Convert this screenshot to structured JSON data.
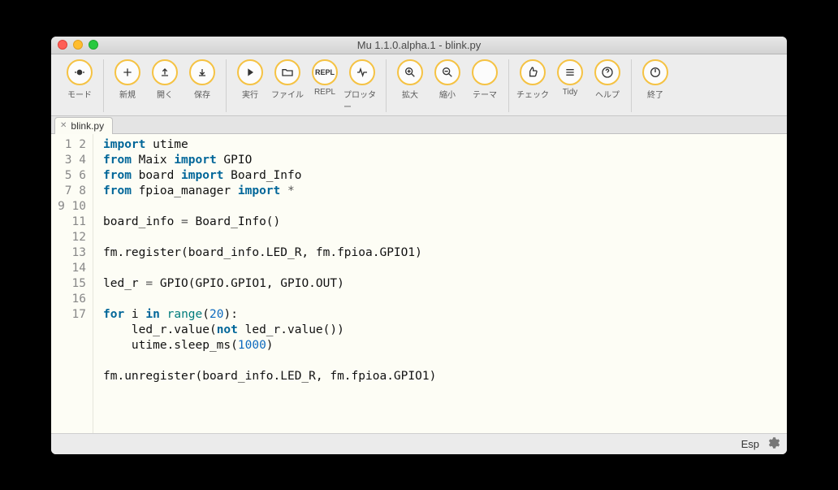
{
  "window": {
    "title": "Mu 1.1.0.alpha.1 - blink.py"
  },
  "toolbar": {
    "groups": [
      [
        {
          "id": "mode",
          "label": "モード",
          "icon": "mode"
        }
      ],
      [
        {
          "id": "new",
          "label": "新規",
          "icon": "plus"
        },
        {
          "id": "open",
          "label": "開く",
          "icon": "upload"
        },
        {
          "id": "save",
          "label": "保存",
          "icon": "download"
        }
      ],
      [
        {
          "id": "run",
          "label": "実行",
          "icon": "play"
        },
        {
          "id": "files",
          "label": "ファイル",
          "icon": "folder"
        },
        {
          "id": "repl",
          "label": "REPL",
          "icon": "kbd",
          "text": "REPL"
        },
        {
          "id": "plotter",
          "label": "プロッター",
          "icon": "pulse"
        }
      ],
      [
        {
          "id": "zoomin",
          "label": "拡大",
          "icon": "zoomin"
        },
        {
          "id": "zoomout",
          "label": "縮小",
          "icon": "zoomout"
        },
        {
          "id": "theme",
          "label": "テーマ",
          "icon": "moon"
        }
      ],
      [
        {
          "id": "check",
          "label": "チェック",
          "icon": "thumb"
        },
        {
          "id": "tidy",
          "label": "Tidy",
          "icon": "list"
        },
        {
          "id": "help",
          "label": "ヘルプ",
          "icon": "help"
        }
      ],
      [
        {
          "id": "quit",
          "label": "終了",
          "icon": "power"
        }
      ]
    ]
  },
  "tab": {
    "filename": "blink.py"
  },
  "code": {
    "lines": 17,
    "tokens": [
      [
        {
          "c": "kw",
          "t": "import"
        },
        {
          "c": "id",
          "t": " utime"
        }
      ],
      [
        {
          "c": "kw",
          "t": "from"
        },
        {
          "c": "id",
          "t": " Maix "
        },
        {
          "c": "kw",
          "t": "import"
        },
        {
          "c": "id",
          "t": " GPIO"
        }
      ],
      [
        {
          "c": "kw",
          "t": "from"
        },
        {
          "c": "id",
          "t": " board "
        },
        {
          "c": "kw",
          "t": "import"
        },
        {
          "c": "id",
          "t": " Board_Info"
        }
      ],
      [
        {
          "c": "kw",
          "t": "from"
        },
        {
          "c": "id",
          "t": " fpioa_manager "
        },
        {
          "c": "kw",
          "t": "import"
        },
        {
          "c": "op",
          "t": " *"
        }
      ],
      [],
      [
        {
          "c": "id",
          "t": "board_info "
        },
        {
          "c": "op",
          "t": "="
        },
        {
          "c": "id",
          "t": " Board_Info()"
        }
      ],
      [],
      [
        {
          "c": "id",
          "t": "fm.register(board_info.LED_R, fm.fpioa.GPIO1)"
        }
      ],
      [],
      [
        {
          "c": "id",
          "t": "led_r "
        },
        {
          "c": "op",
          "t": "="
        },
        {
          "c": "id",
          "t": " GPIO(GPIO.GPIO1, GPIO.OUT)"
        }
      ],
      [],
      [
        {
          "c": "kw",
          "t": "for"
        },
        {
          "c": "id",
          "t": " i "
        },
        {
          "c": "kw",
          "t": "in"
        },
        {
          "c": "id",
          "t": " "
        },
        {
          "c": "fn",
          "t": "range"
        },
        {
          "c": "id",
          "t": "("
        },
        {
          "c": "num",
          "t": "20"
        },
        {
          "c": "id",
          "t": "):"
        }
      ],
      [
        {
          "c": "id",
          "t": "    led_r.value("
        },
        {
          "c": "kw",
          "t": "not"
        },
        {
          "c": "id",
          "t": " led_r.value())"
        }
      ],
      [
        {
          "c": "id",
          "t": "    utime.sleep_ms("
        },
        {
          "c": "num",
          "t": "1000"
        },
        {
          "c": "id",
          "t": ")"
        }
      ],
      [],
      [
        {
          "c": "id",
          "t": "fm.unregister(board_info.LED_R, fm.fpioa.GPIO1)"
        }
      ],
      []
    ]
  },
  "status": {
    "mode": "Esp"
  }
}
